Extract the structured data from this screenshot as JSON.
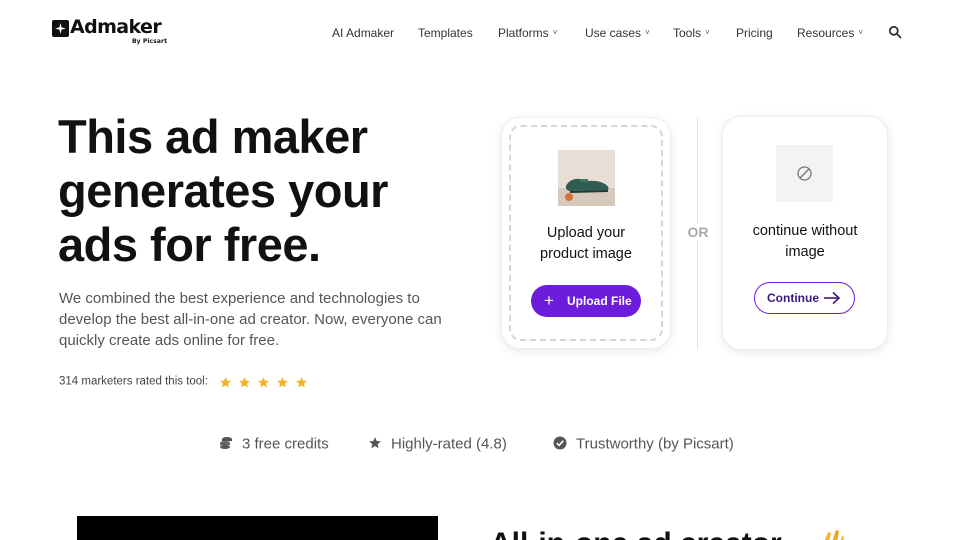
{
  "nav": {
    "logo_text": "Admaker",
    "logo_sub": "By Picsart",
    "items": [
      {
        "label": "AI Admaker",
        "dropdown": false
      },
      {
        "label": "Templates",
        "dropdown": false
      },
      {
        "label": "Platforms",
        "dropdown": true
      },
      {
        "label": "Use cases",
        "dropdown": true
      },
      {
        "label": "Tools",
        "dropdown": true
      },
      {
        "label": "Pricing",
        "dropdown": false
      },
      {
        "label": "Resources",
        "dropdown": true
      }
    ],
    "search_icon": "search-icon",
    "dropdown_glyph": "˅"
  },
  "hero": {
    "title_lines": [
      "This ad maker",
      "generates your",
      "ads for free."
    ],
    "description": "We combined the best experience and technologies to develop the best all-in-one ad creator. Now, everyone can quickly create ads online for free.",
    "rating_text": "314 marketers rated this tool:",
    "rating_stars": 5,
    "star_color": "#f0b429"
  },
  "upload_card": {
    "title_line1": "Upload your",
    "title_line2": "product image",
    "button_label": "Upload File",
    "button_icon": "plus-icon"
  },
  "or_label": "OR",
  "noimage_card": {
    "title_line1": "continue without",
    "title_line2": "image",
    "button_label": "Continue",
    "icon": "no-image-icon",
    "button_icon": "arrow-right-icon"
  },
  "features": [
    {
      "icon": "coins-icon",
      "label": "3 free credits"
    },
    {
      "icon": "star-icon",
      "label": "Highly-rated (4.8)"
    },
    {
      "icon": "check-circle-icon",
      "label": "Trustworthy (by Picsart)"
    }
  ],
  "bottom": {
    "heading_partial": "All-in-one ad creator"
  },
  "colors": {
    "accent": "#6c1ddc",
    "text": "#111111",
    "muted": "#555555"
  }
}
